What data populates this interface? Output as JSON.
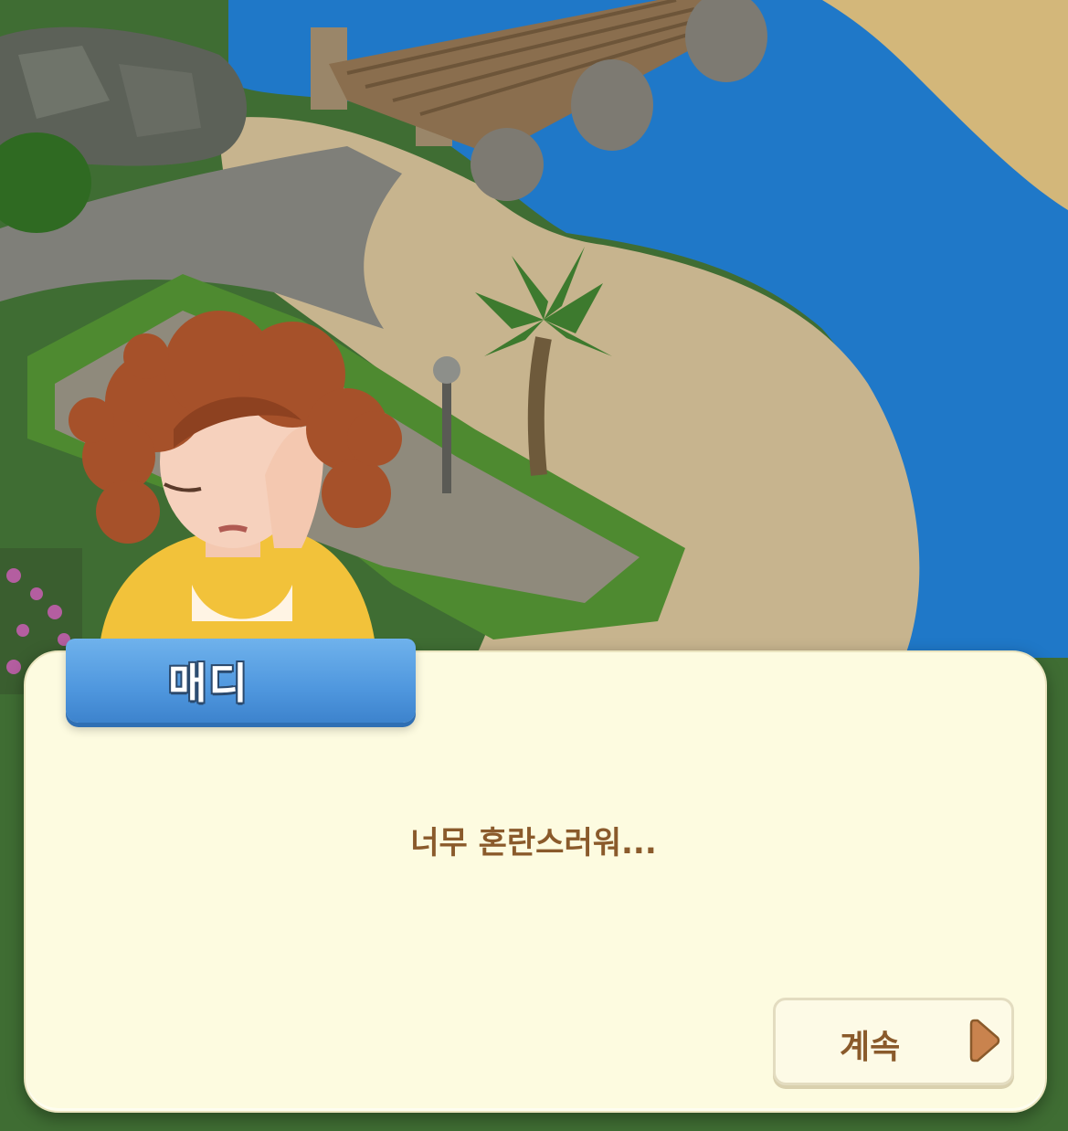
{
  "dialog": {
    "speaker_name": "매디",
    "message": "너무 혼란스러워...",
    "continue_label": "계속"
  },
  "icons": {
    "continue_arrow": "play-arrow-icon"
  },
  "colors": {
    "dialog_bg": "#fdfbe0",
    "name_tag_blue": "#4f97de",
    "text_brown": "#8a5a2b",
    "arrow_fill": "#c9834e",
    "water": "#1f78c8",
    "sand": "#c7b48e"
  }
}
